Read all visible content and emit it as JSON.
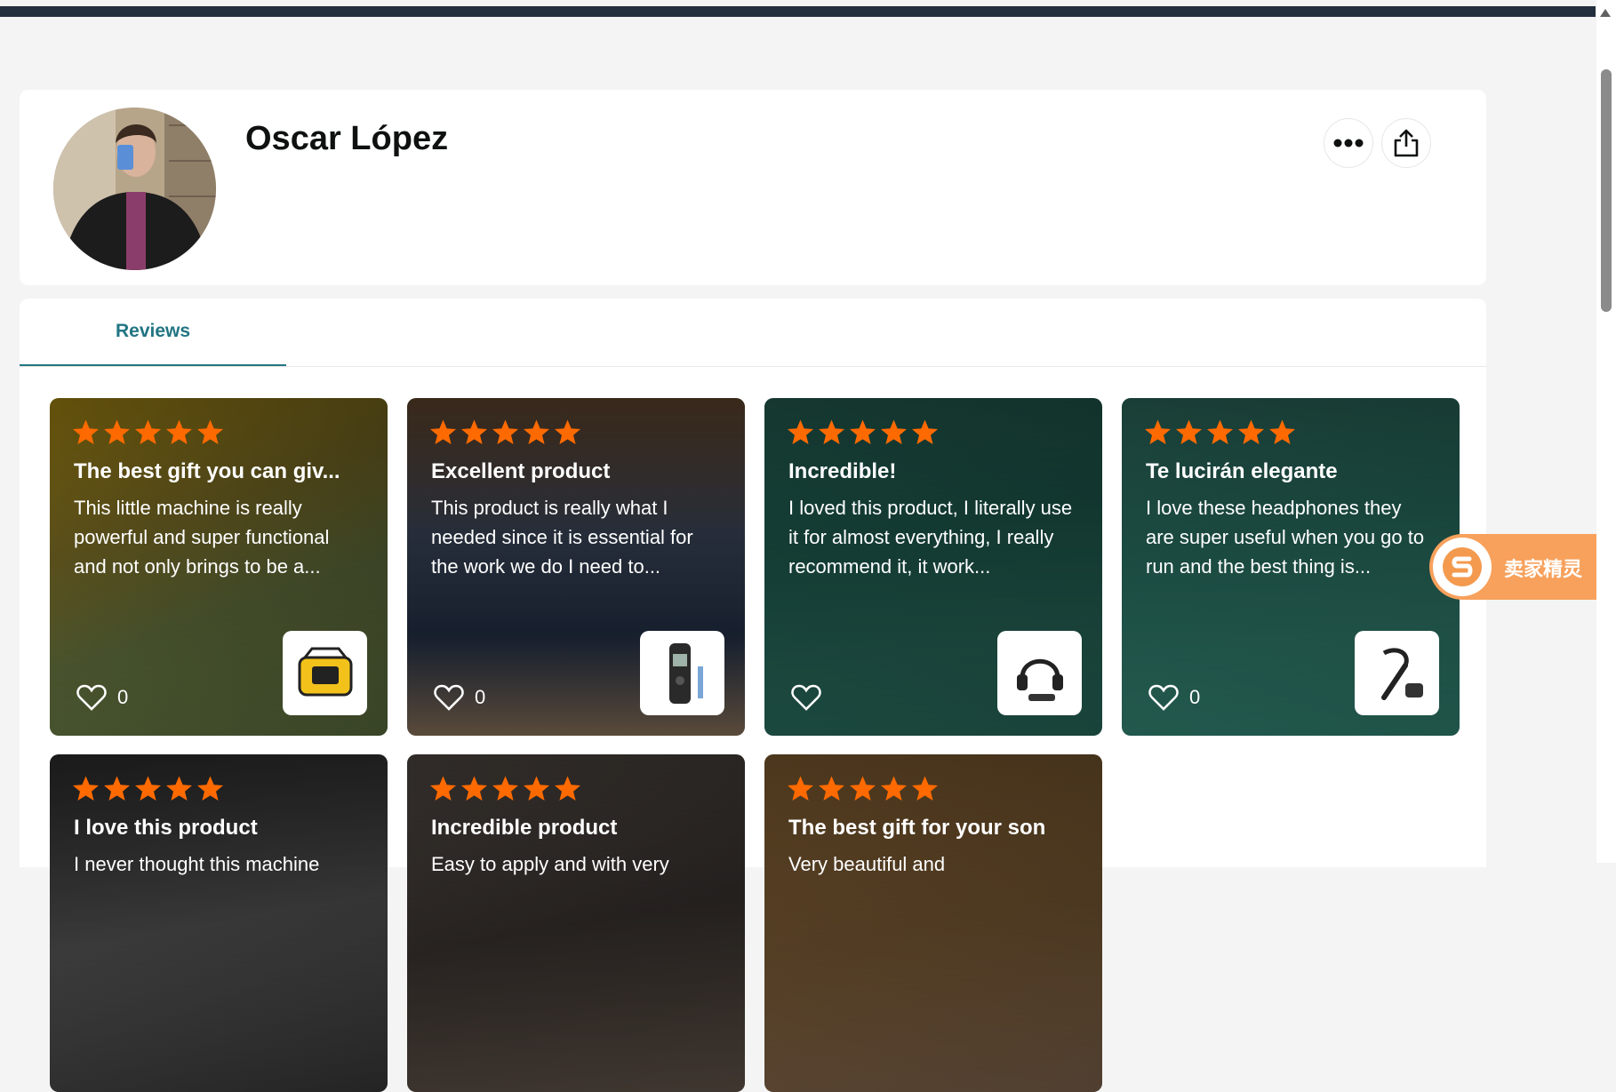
{
  "profile": {
    "name": "Oscar López",
    "more_icon": "more-dots-icon",
    "share_icon": "share-icon"
  },
  "tabs": [
    {
      "label": "Reviews",
      "active": true
    }
  ],
  "reviews": [
    {
      "rating": 5,
      "title": "The best gift you can giv...",
      "body": "This little machine is really powerful and super functional and not only brings to be a...",
      "likes": "0",
      "product_icon": "air-compressor-icon"
    },
    {
      "rating": 5,
      "title": "Excellent product",
      "body": "This product is really what I needed since it is essential for the work we do I need to...",
      "likes": "0",
      "product_icon": "multimeter-icon"
    },
    {
      "rating": 5,
      "title": "Incredible!",
      "body": "I loved this product, I literally use it for almost everything, I really recommend it, it work...",
      "likes": "",
      "product_icon": "headset-icon"
    },
    {
      "rating": 5,
      "title": "Te lucirán elegante",
      "body": "I love these headphones they are super useful when you go to run and the best thing is...",
      "likes": "0",
      "product_icon": "earpiece-icon"
    },
    {
      "rating": 5,
      "title": "I love this product",
      "body": "I never thought this machine",
      "likes": "",
      "product_icon": ""
    },
    {
      "rating": 5,
      "title": "Incredible product",
      "body": "Easy to apply and with very",
      "likes": "",
      "product_icon": ""
    },
    {
      "rating": 5,
      "title": "The best gift for your son",
      "body": "Very beautiful and",
      "likes": "",
      "product_icon": ""
    }
  ],
  "widget": {
    "label": "卖家精灵"
  },
  "colors": {
    "star": "#ff6a00",
    "tab_accent": "#227583",
    "topbar": "#232f3e"
  }
}
